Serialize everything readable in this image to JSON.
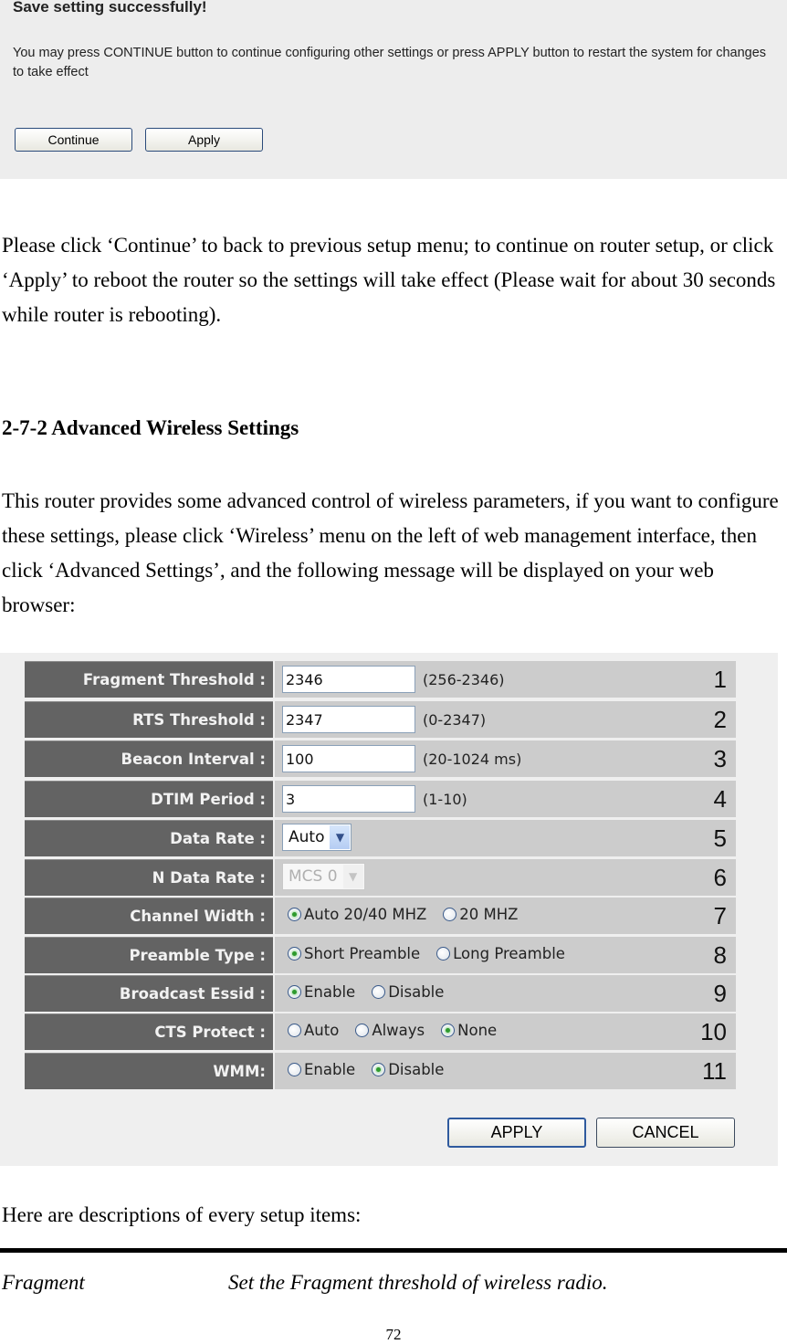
{
  "save_dialog": {
    "title": "Save setting successfully!",
    "message": "You may press CONTINUE button to continue configuring other settings or press APPLY button to restart the system for changes to take effect",
    "continue_label": "Continue",
    "apply_label": "Apply"
  },
  "doc": {
    "para1": "Please click ‘Continue’ to back to previous setup menu; to continue on router setup, or click ‘Apply’ to reboot the router so the settings will take effect (Please wait for about 30 seconds while router is rebooting).",
    "heading": "2-7-2 Advanced Wireless Settings",
    "para2": "This router provides some advanced control of wireless parameters, if you want to configure these settings, please click ‘Wireless’ menu on the left of web management interface, then click ‘Advanced Settings’, and the following message will be displayed on your web browser:",
    "para3": "Here are descriptions of every setup items:",
    "definition": {
      "term": "Fragment",
      "description": "Set the Fragment threshold of wireless radio."
    },
    "page_number": "72"
  },
  "advanced_settings": {
    "rows": [
      {
        "label": "Fragment Threshold :",
        "value": "2346",
        "range": "(256-2346)",
        "num": "1"
      },
      {
        "label": "RTS Threshold :",
        "value": "2347",
        "range": "(0-2347)",
        "num": "2"
      },
      {
        "label": "Beacon Interval :",
        "value": "100",
        "range": "(20-1024 ms)",
        "num": "3"
      },
      {
        "label": "DTIM Period :",
        "value": "3",
        "range": "(1-10)",
        "num": "4"
      },
      {
        "label": "Data Rate :",
        "selected": "Auto",
        "num": "5"
      },
      {
        "label": "N Data Rate :",
        "selected": "MCS 0",
        "num": "6",
        "disabled": true
      },
      {
        "label": "Channel Width :",
        "options": [
          "Auto 20/40 MHZ",
          "20 MHZ"
        ],
        "checked": "Auto 20/40 MHZ",
        "num": "7"
      },
      {
        "label": "Preamble Type :",
        "options": [
          "Short Preamble",
          "Long Preamble"
        ],
        "checked": "Short Preamble",
        "num": "8"
      },
      {
        "label": "Broadcast Essid :",
        "options": [
          "Enable",
          "Disable"
        ],
        "checked": "Enable",
        "num": "9"
      },
      {
        "label": "CTS Protect :",
        "options": [
          "Auto",
          "Always",
          "None"
        ],
        "checked": "None",
        "num": "10"
      },
      {
        "label": "WMM:",
        "options": [
          "Enable",
          "Disable"
        ],
        "checked": "Disable",
        "num": "11"
      }
    ],
    "apply_label": "APPLY",
    "cancel_label": "CANCEL"
  }
}
